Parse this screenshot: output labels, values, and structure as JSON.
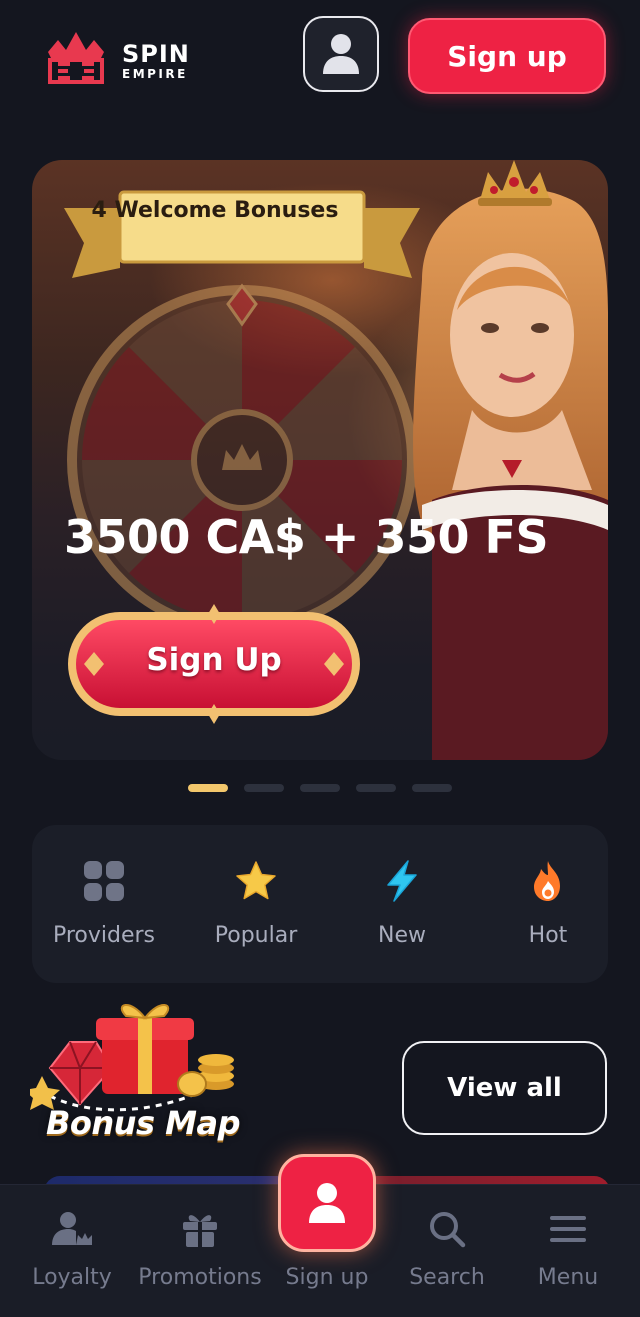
{
  "header": {
    "logo_line1": "SPIN",
    "logo_line2": "EMPIRE",
    "signup_label": "Sign up"
  },
  "banner": {
    "ribbon_text": "4 Welcome Bonuses",
    "amount": "3500 CA$ + 350 FS",
    "button_label": "Sign Up",
    "slide_count": 5,
    "active_slide": 1
  },
  "categories": [
    {
      "label": "Providers",
      "icon": "grid-icon"
    },
    {
      "label": "Popular",
      "icon": "star-icon"
    },
    {
      "label": "New",
      "icon": "lightning-icon"
    },
    {
      "label": "Hot",
      "icon": "flame-icon"
    }
  ],
  "bonus_section": {
    "title": "Bonus Map",
    "view_all_label": "View all"
  },
  "nav": {
    "items": [
      {
        "label": "Loyalty",
        "icon": "crown-user-icon"
      },
      {
        "label": "Promotions",
        "icon": "gift-icon"
      },
      {
        "label": "Sign up",
        "icon": "user-icon"
      },
      {
        "label": "Search",
        "icon": "search-icon"
      },
      {
        "label": "Menu",
        "icon": "menu-icon"
      }
    ]
  },
  "colors": {
    "background": "#14161f",
    "accent": "#ee2244",
    "gold": "#f3c76c",
    "muted_text": "#a9adbd"
  }
}
